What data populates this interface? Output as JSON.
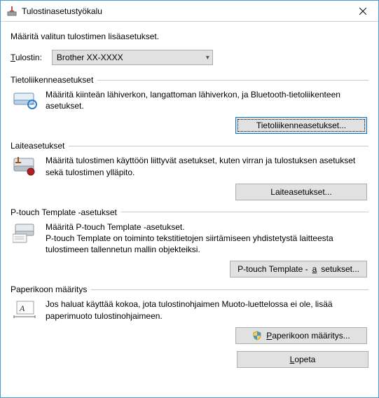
{
  "window": {
    "title": "Tulostinasetustyökalu"
  },
  "heading": "Määritä valitun tulostimen lisäasetukset.",
  "printer": {
    "label_pre": "T",
    "label_post": "ulostin:",
    "selected": "Brother  XX-XXXX"
  },
  "groups": {
    "comm": {
      "title": "Tietoliikenneasetukset",
      "desc": "Määritä kiinteän lähiverkon, langattoman lähiverkon, ja Bluetooth-tietoliikenteen asetukset.",
      "button": "Tietoliikenneasetukset..."
    },
    "device": {
      "title": "Laiteasetukset",
      "desc": "Määritä tulostimen käyttöön liittyvät asetukset, kuten virran ja tulostuksen asetukset sekä tulostimen ylläpito.",
      "button": "Laiteasetukset..."
    },
    "ptouch": {
      "title": "P-touch Template -asetukset",
      "desc": "Määritä P-touch Template -asetukset.\nP-touch Template on toiminto tekstitietojen siirtämiseen yhdistetystä laitteesta tulostimeen tallennetun mallin objekteiksi.",
      "button_pre": "P-touch Template -",
      "button_u": "a",
      "button_post": "setukset..."
    },
    "paper": {
      "title": "Paperikoon määritys",
      "desc": "Jos haluat käyttää kokoa, jota tulostinohjaimen Muoto-luettelossa ei ole, lisää paperimuoto tulostinohjaimeen.",
      "button_u": "P",
      "button_post": "aperikoon määritys..."
    }
  },
  "footer": {
    "quit_u": "L",
    "quit_post": "opeta"
  }
}
